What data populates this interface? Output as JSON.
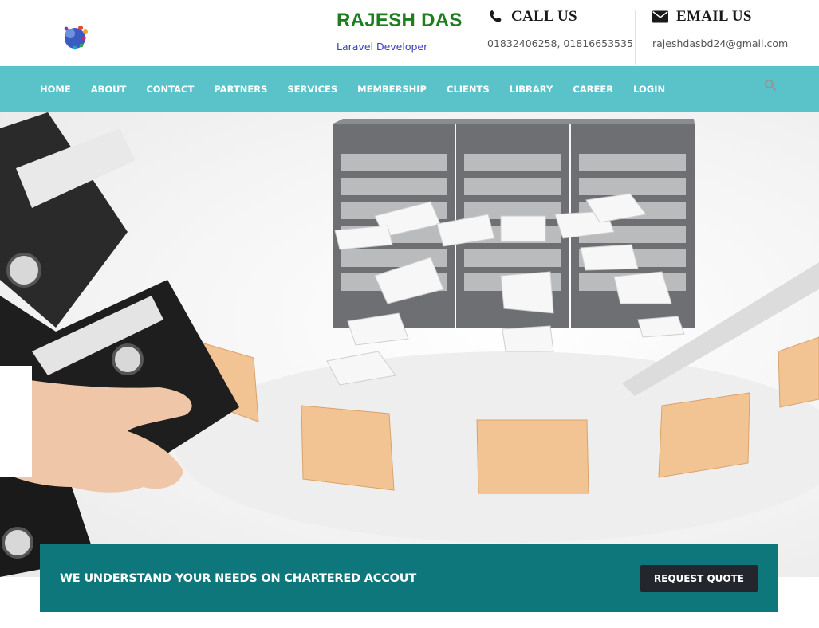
{
  "header": {
    "brand_name": "RAJESH DAS",
    "brand_tagline": "Laravel Developer",
    "call": {
      "title": "CALL US",
      "value": "01832406258, 01816653535",
      "icon": "phone-icon"
    },
    "email": {
      "title": "EMAIL US",
      "value": "rajeshdasbd24@gmail.com",
      "icon": "envelope-icon"
    },
    "logo_icon": "logo-icon"
  },
  "nav": {
    "items": [
      "HOME",
      "ABOUT",
      "CONTACT",
      "PARTNERS",
      "SERVICES",
      "MEMBERSHIP",
      "CLIENTS",
      "LIBRARY",
      "CAREER",
      "LOGIN"
    ],
    "search_icon": "search-icon"
  },
  "banner": {
    "text": "WE UNDERSTAND YOUR NEEDS ON CHARTERED ACCOUT",
    "button_label": "REQUEST QUOTE"
  },
  "colors": {
    "brand_green": "#1e7d1e",
    "tagline_blue": "#3b3bbd",
    "nav_bg": "#5ac3c9",
    "banner_bg": "#0e777b",
    "button_bg": "#23272d"
  }
}
